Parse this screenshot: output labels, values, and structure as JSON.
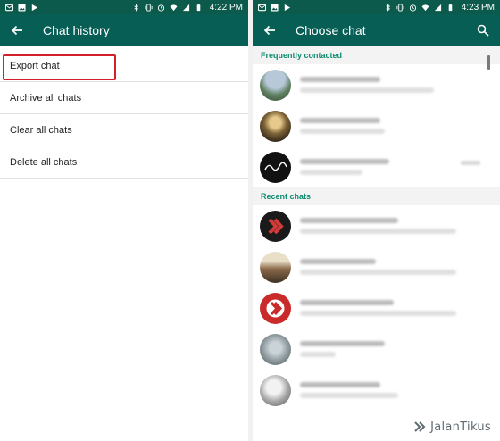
{
  "left_screen": {
    "status": {
      "time": "4:22 PM"
    },
    "appbar": {
      "title": "Chat history"
    },
    "menu": [
      {
        "label": "Export chat"
      },
      {
        "label": "Archive all chats"
      },
      {
        "label": "Clear all chats"
      },
      {
        "label": "Delete all chats"
      }
    ]
  },
  "right_screen": {
    "status": {
      "time": "4:23 PM"
    },
    "appbar": {
      "title": "Choose chat"
    },
    "sections": {
      "frequent": "Frequently contacted",
      "recent": "Recent chats"
    }
  },
  "watermark": {
    "text": "JalanTikus"
  },
  "colors": {
    "appbar": "#075e54",
    "statusbar": "#0b5a4c",
    "section_text": "#0d8a6f",
    "highlight": "#d3202a"
  },
  "icons": [
    "back-arrow-icon",
    "search-icon",
    "wifi-icon",
    "battery-icon",
    "bluetooth-icon",
    "vibrate-icon",
    "alarm-icon",
    "jalantikus-logo-icon"
  ]
}
